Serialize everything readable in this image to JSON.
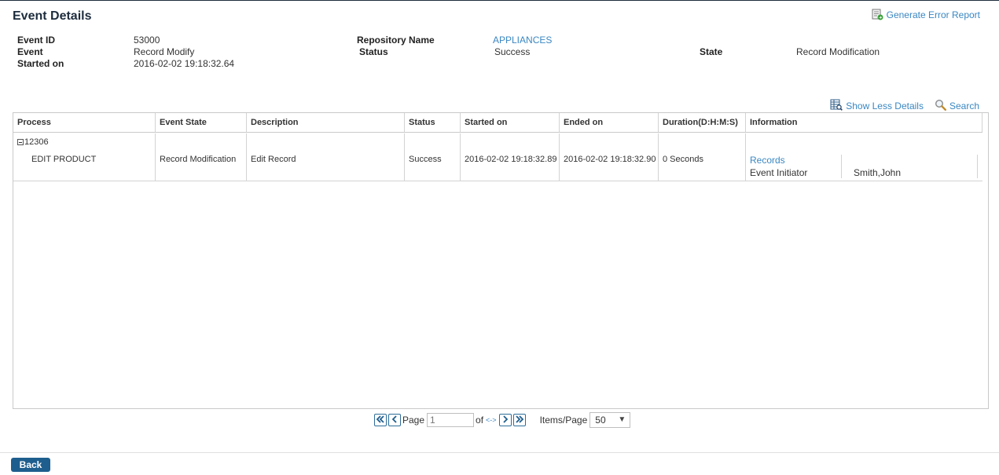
{
  "header": {
    "title": "Event Details",
    "generate_error_report": "Generate Error Report"
  },
  "event": {
    "event_id_label": "Event ID",
    "event_id_value": "53000",
    "event_label": "Event",
    "event_value": "Record Modify",
    "started_on_label": "Started on",
    "started_on_value": "2016-02-02 19:18:32.64",
    "repository_name_label": "Repository Name",
    "repository_name_value": "APPLIANCES",
    "status_label": "Status",
    "status_value": "Success",
    "state_label": "State",
    "state_value": "Record Modification"
  },
  "tools": {
    "show_less_details": "Show Less Details",
    "search": "Search"
  },
  "grid": {
    "columns": [
      "Process",
      "Event State",
      "Description",
      "Status",
      "Started on",
      "Ended on",
      "Duration(D:H:M:S)",
      "Information"
    ],
    "rows": [
      {
        "group_id": "12306",
        "process": "EDIT PRODUCT",
        "event_state": "Record Modification",
        "description": "Edit Record",
        "status": "Success",
        "started_on": "2016-02-02 19:18:32.89",
        "ended_on": "2016-02-02 19:18:32.90",
        "duration": "0 Seconds",
        "info_link": "Records",
        "info_label": "Event Initiator",
        "info_value": "Smith,John"
      }
    ]
  },
  "pager": {
    "page_label": "Page",
    "page_value": "1",
    "of_label": "of",
    "total_link": "<->",
    "items_per_page_label": "Items/Page",
    "items_per_page_value": "50"
  },
  "footer": {
    "back_label": "Back"
  },
  "colors": {
    "link": "#3a87c2",
    "title": "#1d2c3d",
    "button": "#1e5e8e"
  }
}
